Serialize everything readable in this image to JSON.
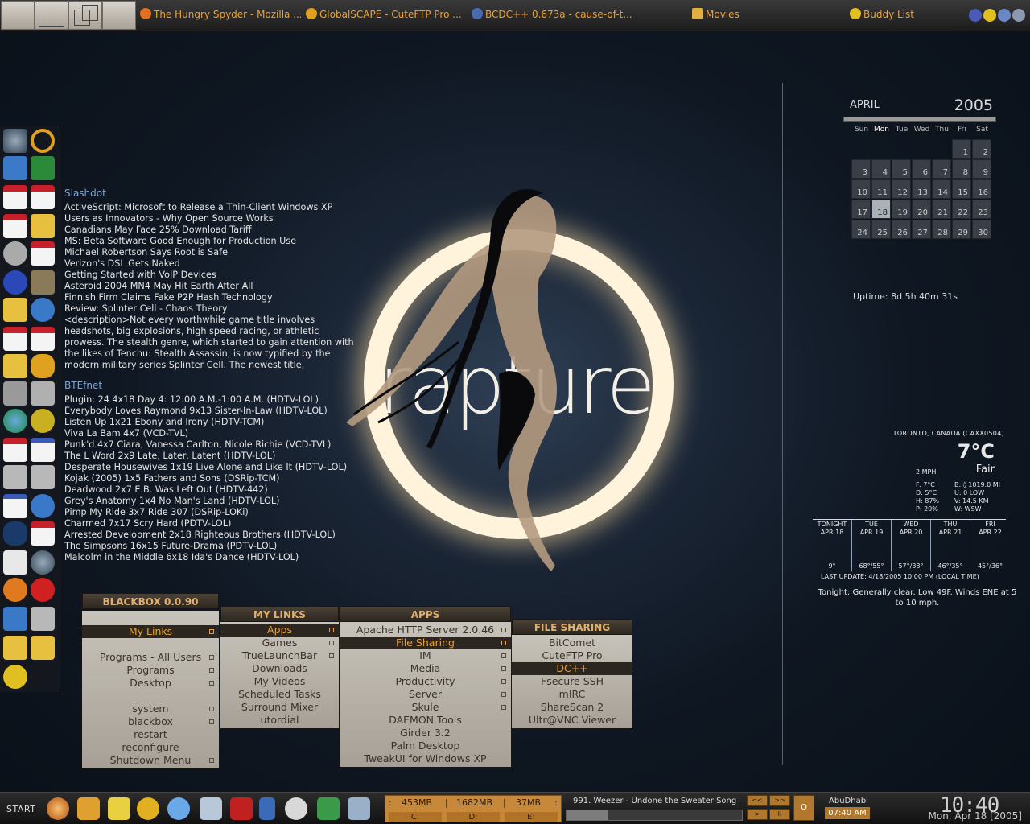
{
  "taskbar": {
    "tasks": [
      {
        "label": "The Hungry Spyder - Mozilla ...",
        "icon": "firefox-icon",
        "color": "#e07020"
      },
      {
        "label": "GlobalSCAPE - CuteFTP Pro ...",
        "icon": "cuteftp-icon",
        "color": "#e0a020"
      },
      {
        "label": "BCDC++ 0.673a - cause-of-t...",
        "icon": "dcpp-icon",
        "color": "#4a6ab0"
      },
      {
        "label": "Movies",
        "icon": "folder-icon",
        "color": "#e0b040"
      },
      {
        "label": "Buddy List",
        "icon": "aim-icon",
        "color": "#e0c020"
      }
    ]
  },
  "feeds": [
    {
      "title": "Slashdot",
      "items": [
        "ActiveScript: Microsoft to Release a Thin-Client Windows XP",
        "Users as Innovators - Why Open Source Works",
        "Canadians May Face 25% Download Tariff",
        "MS: Beta Software Good Enough for Production Use",
        "Michael Robertson Says Root is Safe",
        "Verizon's DSL Gets Naked",
        "Getting Started with VoIP Devices",
        "Asteroid 2004 MN4 May Hit Earth After All",
        "Finnish Firm Claims Fake P2P Hash Technology",
        "Review: Splinter Cell - Chaos Theory"
      ],
      "description": "<description>Not every worthwhile game title involves headshots, big explosions, high speed racing, or athletic prowess. The stealth genre, which started to gain attention with the likes of Tenchu: Stealth Assassin, is now typified by the modern military series Splinter Cell. The newest title,"
    },
    {
      "title": "BTEfnet",
      "items": [
        "Plugin: 24 4x18 Day 4: 12:00 A.M.-1:00 A.M. (HDTV-LOL)",
        "Everybody Loves Raymond 9x13 Sister-In-Law (HDTV-LOL)",
        "Listen Up 1x21 Ebony and Irony (HDTV-TCM)",
        "Viva La Bam 4x7  (VCD-TVL)",
        "Punk'd 4x7 Ciara, Vanessa Carlton, Nicole Richie (VCD-TVL)",
        "The L Word 2x9 Late, Later, Latent (HDTV-LOL)",
        "Desperate Housewives 1x19 Live Alone and Like It (HDTV-LOL)",
        "Kojak (2005) 1x5 Fathers and Sons (DSRip-TCM)",
        "Deadwood 2x7 E.B. Was Left Out (HDTV-442)",
        "Grey's Anatomy 1x4 No Man's Land (HDTV-LOL)",
        "Pimp My Ride 3x7 Ride 307 (DSRip-LOKi)",
        "Charmed 7x17 Scry Hard (PDTV-LOL)",
        "Arrested Development 2x18 Righteous Brothers (HDTV-LOL)",
        "The Simpsons 16x15 Future-Drama (PDTV-LOL)",
        "Malcolm in the Middle 6x18 Ida's Dance (HDTV-LOL)"
      ]
    }
  ],
  "wallpaper": {
    "text": "rapture"
  },
  "calendar": {
    "month": "APRIL",
    "year": "2005",
    "weekdays": [
      "Sun",
      "Mon",
      "Tue",
      "Wed",
      "Thu",
      "Fri",
      "Sat"
    ],
    "first_weekday": 5,
    "days_in_month": 30,
    "today": 18
  },
  "uptime": "Uptime: 8d 5h 40m 31s",
  "weather": {
    "location": "TORONTO, CANADA (CAXX0504)",
    "temp": "7°C",
    "condition": "Fair",
    "wind": "2 MPH",
    "stats_left": [
      "F: 7°C",
      "D: 5°C",
      "H: 87%",
      "P: 20%"
    ],
    "stats_right": [
      "B: ◊ 1019.0 MI",
      "U: 0 LOW",
      "V: 14.5 KM",
      "W: WSW"
    ],
    "forecast": [
      {
        "day": "TONIGHT",
        "date": "APR 18",
        "temp": "9°"
      },
      {
        "day": "TUE",
        "date": "APR 19",
        "temp": "68°/55°"
      },
      {
        "day": "WED",
        "date": "APR 20",
        "temp": "57°/38°"
      },
      {
        "day": "THU",
        "date": "APR 21",
        "temp": "46°/35°"
      },
      {
        "day": "FRI",
        "date": "APR 22",
        "temp": "45°/36°"
      }
    ],
    "last_update": "LAST UPDATE: 4/18/2005 10:00 PM (LOCAL TIME)",
    "tonight": "Tonight: Generally clear. Low 49F. Winds ENE at 5 to 10 mph."
  },
  "menus": {
    "blackbox": {
      "title": "BLACKBOX 0.0.90",
      "items": [
        {
          "label": "",
          "sub": false
        },
        {
          "label": "My Links",
          "sub": true,
          "selected": true
        },
        {
          "label": "",
          "sub": false
        },
        {
          "label": "Programs - All Users",
          "sub": true
        },
        {
          "label": "Programs",
          "sub": true
        },
        {
          "label": "Desktop",
          "sub": true
        },
        {
          "label": "",
          "sub": false
        },
        {
          "label": "system",
          "sub": true
        },
        {
          "label": "blackbox",
          "sub": true
        },
        {
          "label": "restart",
          "sub": false
        },
        {
          "label": "reconfigure",
          "sub": false
        },
        {
          "label": "Shutdown Menu",
          "sub": true
        }
      ]
    },
    "mylinks": {
      "title": "MY LINKS",
      "items": [
        {
          "label": "Apps",
          "sub": true,
          "selected": true
        },
        {
          "label": "Games",
          "sub": true
        },
        {
          "label": "TrueLaunchBar",
          "sub": true
        },
        {
          "label": "Downloads",
          "sub": false
        },
        {
          "label": "My Videos",
          "sub": false
        },
        {
          "label": "Scheduled Tasks",
          "sub": false
        },
        {
          "label": "Surround Mixer",
          "sub": false
        },
        {
          "label": "utordial",
          "sub": false
        }
      ]
    },
    "apps": {
      "title": "APPS",
      "items": [
        {
          "label": "Apache HTTP Server 2.0.46",
          "sub": true
        },
        {
          "label": "File Sharing",
          "sub": true,
          "selected": true
        },
        {
          "label": "IM",
          "sub": true
        },
        {
          "label": "Media",
          "sub": true
        },
        {
          "label": "Productivity",
          "sub": true
        },
        {
          "label": "Server",
          "sub": true
        },
        {
          "label": "Skule",
          "sub": true
        },
        {
          "label": "DAEMON Tools",
          "sub": false
        },
        {
          "label": "Girder 3.2",
          "sub": false
        },
        {
          "label": "Palm Desktop",
          "sub": false
        },
        {
          "label": "TweakUI for Windows XP",
          "sub": false
        }
      ]
    },
    "filesharing": {
      "title": "FILE SHARING",
      "items": [
        {
          "label": "BitComet",
          "sub": false
        },
        {
          "label": "CuteFTP Pro",
          "sub": false
        },
        {
          "label": "DC++",
          "sub": false,
          "selected": true
        },
        {
          "label": "Fsecure SSH",
          "sub": false
        },
        {
          "label": "mIRC",
          "sub": false
        },
        {
          "label": "ShareScan 2",
          "sub": false
        },
        {
          "label": "Ultr@VNC Viewer",
          "sub": false
        }
      ]
    }
  },
  "bottombar": {
    "start_label": "START",
    "drives": {
      "values": [
        "453MB",
        "1682MB",
        "37MB"
      ],
      "labels": [
        "C:",
        "D:",
        "E:"
      ]
    },
    "now_playing": {
      "song": "991. Weezer - Undone the Sweater Song",
      "progress": 0.24
    },
    "controls": {
      "prev": "<<",
      "next": ">>",
      "play": ">",
      "pause": "II",
      "stop": "O"
    },
    "timezone": {
      "name": "AbuDhabi",
      "time": "07:40 AM"
    },
    "clock": "10:40",
    "date": "Mon, Apr 18 [2005]"
  }
}
